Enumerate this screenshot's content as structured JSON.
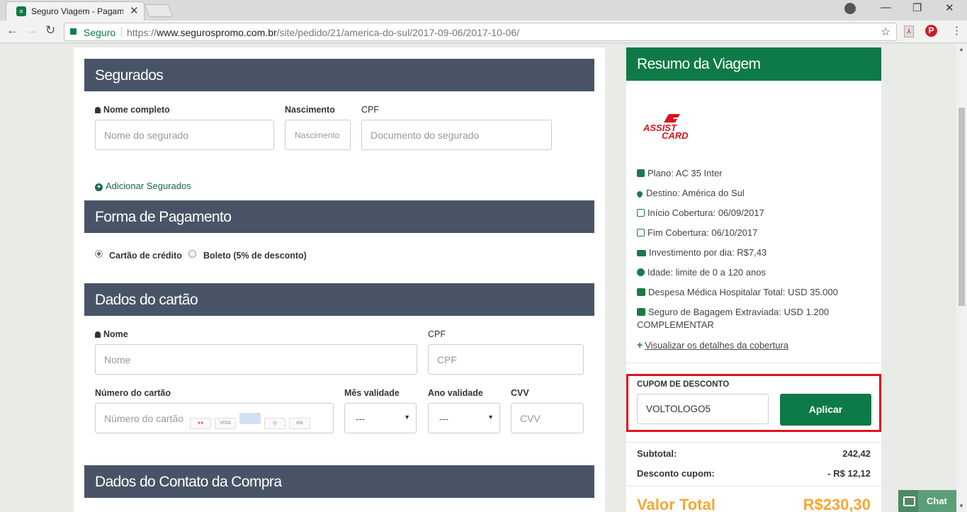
{
  "browser": {
    "tab_title": "Seguro Viagem - Pagamento",
    "tab_close": "✕",
    "secure_label": "Seguro",
    "url_prefix": "https://",
    "url_host": "www.segurospromo.com.br",
    "url_path": "/site/pedido/21/america-do-sul/2017-09-06/2017-10-06/"
  },
  "segurados": {
    "title": "Segurados",
    "name_label": "Nome completo",
    "name_placeholder": "Nome do segurado",
    "birth_label": "Nascimento",
    "birth_placeholder": "Nascimento",
    "cpf_label": "CPF",
    "cpf_placeholder": "Documento do segurado",
    "add_link": "Adicionar Segurados"
  },
  "pagamento": {
    "title": "Forma de Pagamento",
    "option_card": "Cartão de crédito",
    "option_boleto": "Boleto (5% de desconto)",
    "selected": "Cartão de crédito"
  },
  "cartao": {
    "title": "Dados do cartão",
    "name_label": "Nome",
    "name_placeholder": "Nome",
    "cpf_label": "CPF",
    "cpf_placeholder": "CPF",
    "number_label": "Número do cartão",
    "number_placeholder": "Número do cartão",
    "card_brands": [
      "",
      "VISA",
      "",
      "",
      "elo"
    ],
    "month_label": "Mês validade",
    "month_value": "---",
    "year_label": "Ano validade",
    "year_value": "---",
    "cvv_label": "CVV",
    "cvv_placeholder": "CVV"
  },
  "contato": {
    "title": "Dados do Contato da Compra"
  },
  "resumo": {
    "title": "Resumo da Viagem",
    "plano": "Plano: AC 35 Inter",
    "destino": "Destino: América do Sul",
    "inicio": "Início Cobertura: 06/09/2017",
    "fim": "Fim Cobertura: 06/10/2017",
    "investimento": "Investimento por dia: R$7,43",
    "idade": "Idade: limite de 0 a 120 anos",
    "despesa": "Despesa Médica Hospitalar Total: USD 35.000",
    "bagagem_line1": "Seguro de Bagagem Extraviada: USD 1.200",
    "bagagem_line2": "COMPLEMENTAR",
    "details_link": "Visualizar os detalhes da cobertura",
    "coupon_label": "CUPOM DE DESCONTO",
    "coupon_value": "VOLTOLOGO5",
    "apply_button": "Aplicar",
    "subtotal_label": "Subtotal:",
    "subtotal_value": "242,42",
    "desconto_label": "Desconto cupom:",
    "desconto_value": "- R$ 12,12",
    "total_label": "Valor Total",
    "total_value": "R$230,30"
  },
  "chat": {
    "label": "Chat"
  },
  "colors": {
    "header": "#485466",
    "brand_green": "#0d7a47",
    "highlight": "#e1121e",
    "total": "#f4a835"
  }
}
